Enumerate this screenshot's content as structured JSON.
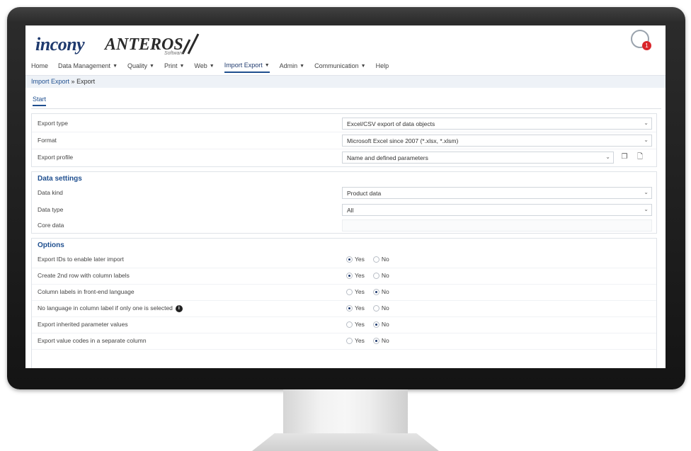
{
  "header": {
    "logo_main": "incony",
    "logo_product": "ANTEROS",
    "logo_product_sub": "Software",
    "notification_count": "1"
  },
  "nav": [
    {
      "label": "Home",
      "has_caret": false
    },
    {
      "label": "Data Management",
      "has_caret": true
    },
    {
      "label": "Quality",
      "has_caret": true
    },
    {
      "label": "Print",
      "has_caret": true
    },
    {
      "label": "Web",
      "has_caret": true
    },
    {
      "label": "Import Export",
      "has_caret": true,
      "active": true
    },
    {
      "label": "Admin",
      "has_caret": true
    },
    {
      "label": "Communication",
      "has_caret": true
    },
    {
      "label": "Help",
      "has_caret": false
    }
  ],
  "breadcrumb": {
    "parent": "Import Export",
    "separator": "»",
    "current": "Export"
  },
  "tab": {
    "label": "Start"
  },
  "export_settings": {
    "export_type_label": "Export type",
    "export_type_value": "Excel/CSV export of data objects",
    "format_label": "Format",
    "format_value": "Microsoft Excel since 2007 (*.xlsx, *.xlsm)",
    "profile_label": "Export profile",
    "profile_value": "Name and defined parameters"
  },
  "data_settings": {
    "title": "Data settings",
    "data_kind_label": "Data kind",
    "data_kind_value": "Product data",
    "data_type_label": "Data type",
    "data_type_value": "All",
    "core_data_label": "Core data"
  },
  "options": {
    "title": "Options",
    "yes": "Yes",
    "no": "No",
    "rows": [
      {
        "label": "Export IDs to enable later import",
        "selected": "yes"
      },
      {
        "label": "Create 2nd row with column labels",
        "selected": "yes"
      },
      {
        "label": "Column labels in front-end language",
        "selected": "no"
      },
      {
        "label": "No language in column label if only one is selected",
        "selected": "yes",
        "info": true
      },
      {
        "label": "Export inherited parameter values",
        "selected": "no"
      },
      {
        "label": "Export value codes in a separate column",
        "selected": "no"
      }
    ]
  },
  "icons": {
    "chevron": "⌄",
    "copy": "❐",
    "delete": "🗋",
    "info": "i"
  }
}
